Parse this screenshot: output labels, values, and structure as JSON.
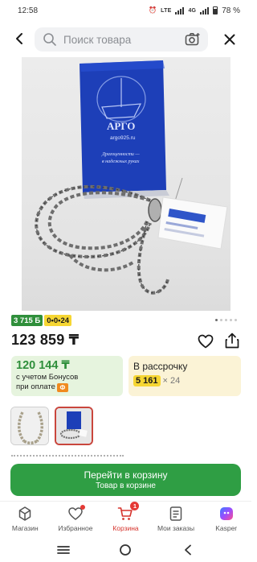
{
  "status_bar": {
    "time": "12:58",
    "network": "4G",
    "lte_badge": "LTE",
    "battery": "78 %"
  },
  "search": {
    "placeholder": "Поиск товара"
  },
  "product": {
    "card_lines": [
      "АРГО",
      "argo925.ru",
      "Драгоценности —",
      "в надежных руках"
    ],
    "badges": {
      "bonus": "3 715 Б",
      "installment": "0•0•24"
    },
    "gallery": {
      "total_dots": 5,
      "active_dot": 1
    },
    "price": "123 859 ₸"
  },
  "payment": {
    "bonus_price": "120 144 ₸",
    "bonus_line1": "с учетом Бонусов",
    "bonus_line2": "при оплате",
    "bonus_badge": "Ф",
    "installment_title": "В рассрочку",
    "installment_amount": "5 161",
    "installment_times": "× 24"
  },
  "cart_button": {
    "label": "Перейти в корзину",
    "sub": "Товар в корзине"
  },
  "bottom_nav": {
    "items": [
      {
        "label": "Магазин",
        "icon": "store-icon"
      },
      {
        "label": "Избранное",
        "icon": "heart-icon"
      },
      {
        "label": "Корзина",
        "icon": "cart-icon",
        "count": "1"
      },
      {
        "label": "Мои заказы",
        "icon": "orders-icon"
      },
      {
        "label": "Kasper",
        "icon": "kaspi-icon"
      }
    ]
  },
  "colors": {
    "brand_green": "#2f9e44",
    "brand_red": "#d5322b",
    "bonus_bg": "#e6f4de",
    "installment_bg": "#fbf3d6",
    "installment_yellow": "#f6d633"
  }
}
